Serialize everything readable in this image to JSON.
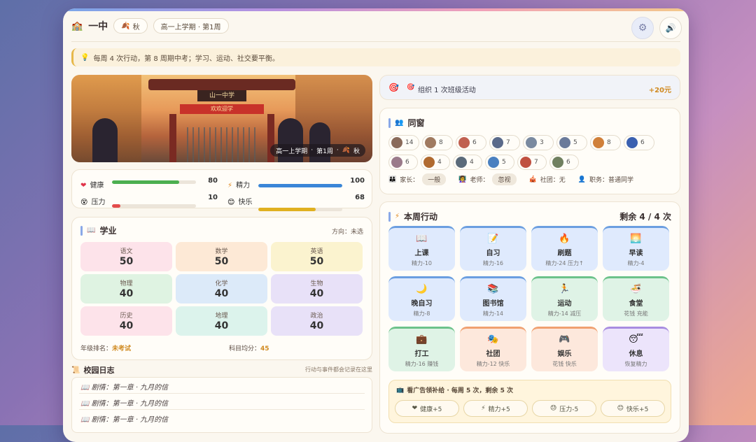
{
  "header": {
    "school_name": "一中",
    "season_label": "秋",
    "term_label": "高一上学期 · 第1周",
    "settings_icon": "gear-icon",
    "sound_icon": "speaker-icon"
  },
  "notice": {
    "text": "每周 4 次行动，第 8 周期中考；学习、运动、社交要平衡。"
  },
  "hero": {
    "image_label": "[school gate scene]",
    "gate_sign": "山一中学",
    "banner": "欢欢迎学",
    "caption_term": "高一上学期",
    "caption_week": "第1周",
    "caption_season": "秋"
  },
  "stats": [
    {
      "label": "健康",
      "icon": "heart-icon",
      "value": 80,
      "fraction": 0.8,
      "color": "#4caf50"
    },
    {
      "label": "精力",
      "icon": "lightning-icon",
      "value": 100,
      "fraction": 1.0,
      "color": "#3a86d8"
    },
    {
      "label": "压力",
      "icon": "stress-face-icon",
      "value": 10,
      "fraction": 0.1,
      "color": "#e34b4b"
    },
    {
      "label": "快乐",
      "icon": "smile-icon",
      "value": 68,
      "fraction": 0.68,
      "color": "#e0b020"
    }
  ],
  "academics": {
    "title": "学业",
    "direction": "方向：未选",
    "subjects": [
      {
        "name": "语文",
        "score": "50",
        "bg": "#fde3ea"
      },
      {
        "name": "数学",
        "score": "50",
        "bg": "#fde9d6"
      },
      {
        "name": "英语",
        "score": "50",
        "bg": "#fbf3cf"
      },
      {
        "name": "物理",
        "score": "40",
        "bg": "#dff3e2"
      },
      {
        "name": "化学",
        "score": "40",
        "bg": "#dceaf9"
      },
      {
        "name": "生物",
        "score": "40",
        "bg": "#e8e1f8"
      },
      {
        "name": "历史",
        "score": "40",
        "bg": "#fde3ea"
      },
      {
        "name": "地理",
        "score": "40",
        "bg": "#dcf3ec"
      },
      {
        "name": "政治",
        "score": "40",
        "bg": "#e8e1f8"
      }
    ],
    "rank_label": "年级排名：",
    "rank_value": "未考试",
    "avg_label": "科目均分：",
    "avg_value": "45"
  },
  "journal": {
    "title": "校园日志",
    "hint": "行动与事件都会记录在这里",
    "entries": [
      "剧情：第一章 · 九月的信",
      "剧情：第一章 · 九月的信",
      "剧情：第一章 · 九月的信"
    ]
  },
  "task": {
    "text": "组织 1 次班级活动",
    "reward": "+20元"
  },
  "classmates": {
    "title": "同窗",
    "people": [
      {
        "value": "14",
        "color": "#8a6a5a"
      },
      {
        "value": "8",
        "color": "#a07a60"
      },
      {
        "value": "6",
        "color": "#c06050"
      },
      {
        "value": "7",
        "color": "#5a6a8a"
      },
      {
        "value": "3",
        "color": "#7a8aa0"
      },
      {
        "value": "5",
        "color": "#6a7a9a"
      },
      {
        "value": "8",
        "color": "#d0803a"
      },
      {
        "value": "6",
        "color": "#3a60b0"
      },
      {
        "value": "6",
        "color": "#9a7a8a"
      },
      {
        "value": "4",
        "color": "#b06a30"
      },
      {
        "value": "4",
        "color": "#5a6a7a"
      },
      {
        "value": "5",
        "color": "#4a80c0"
      },
      {
        "value": "7",
        "color": "#c05040"
      },
      {
        "value": "6",
        "color": "#708060"
      }
    ],
    "parent_label": "家长：",
    "parent_value": "一般",
    "teacher_label": "老师：",
    "teacher_value": "忽视",
    "club_text": "社团：无",
    "duty_text": "职务：普通同学"
  },
  "actions": {
    "title": "本周行动",
    "remaining": "剩余 4 / 4 次",
    "items": [
      {
        "name": "上课",
        "sub": "精力-10",
        "icon": "book-icon",
        "glyph": "📖",
        "tone": "blue"
      },
      {
        "name": "自习",
        "sub": "精力-16",
        "icon": "notebook-icon",
        "glyph": "📝",
        "tone": "blue"
      },
      {
        "name": "刷题",
        "sub": "精力-24 压力↑",
        "icon": "fire-icon",
        "glyph": "🔥",
        "tone": "blue"
      },
      {
        "name": "早读",
        "sub": "精力-4",
        "icon": "sunrise-icon",
        "glyph": "🌅",
        "tone": "blue"
      },
      {
        "name": "晚自习",
        "sub": "精力-8",
        "icon": "moon-icon",
        "glyph": "🌙",
        "tone": "blue"
      },
      {
        "name": "图书馆",
        "sub": "精力-14",
        "icon": "books-icon",
        "glyph": "📚",
        "tone": "blue"
      },
      {
        "name": "运动",
        "sub": "精力-14 减压",
        "icon": "running-icon",
        "glyph": "🏃",
        "tone": "green"
      },
      {
        "name": "食堂",
        "sub": "花钱 充能",
        "icon": "bowl-icon",
        "glyph": "🍜",
        "tone": "green"
      },
      {
        "name": "打工",
        "sub": "精力-16 赚钱",
        "icon": "briefcase-icon",
        "glyph": "💼",
        "tone": "green"
      },
      {
        "name": "社团",
        "sub": "精力-12 快乐",
        "icon": "drama-icon",
        "glyph": "🎭",
        "tone": "orange"
      },
      {
        "name": "娱乐",
        "sub": "花钱 快乐",
        "icon": "gamepad-icon",
        "glyph": "🎮",
        "tone": "orange"
      },
      {
        "name": "休息",
        "sub": "恢复精力",
        "icon": "sleep-icon",
        "glyph": "😴",
        "tone": "purple"
      }
    ]
  },
  "ad": {
    "text": "看广告领补给 · 每周 5 次，剩余 5 次",
    "rewards": [
      {
        "label": "健康+5",
        "glyph": "❤"
      },
      {
        "label": "精力+5",
        "glyph": "⚡"
      },
      {
        "label": "压力-5",
        "glyph": "😓"
      },
      {
        "label": "快乐+5",
        "glyph": "😊"
      }
    ]
  }
}
